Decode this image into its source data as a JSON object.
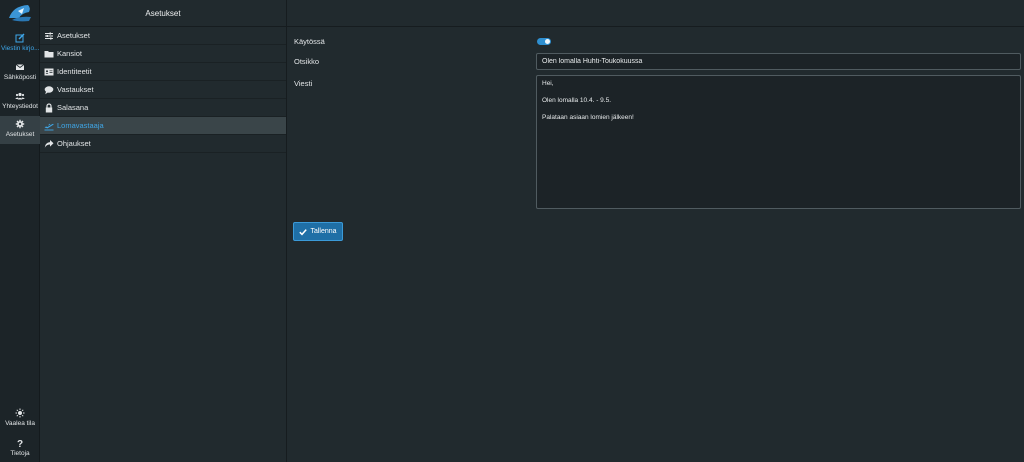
{
  "rail": {
    "items": [
      {
        "label": "Viestin kirjo...",
        "icon": "compose-icon"
      },
      {
        "label": "Sähköposti",
        "icon": "envelope-icon"
      },
      {
        "label": "Yhteystiedot",
        "icon": "users-icon"
      },
      {
        "label": "Asetukset",
        "icon": "gear-icon"
      }
    ],
    "bottom": [
      {
        "label": "Vaalea tila",
        "icon": "sun-icon"
      },
      {
        "label": "Tietoja",
        "icon": "question-icon"
      }
    ]
  },
  "menu": {
    "title": "Asetukset",
    "items": [
      {
        "label": "Asetukset",
        "icon": "sliders-icon"
      },
      {
        "label": "Kansiot",
        "icon": "folder-icon"
      },
      {
        "label": "Identiteetit",
        "icon": "id-card-icon"
      },
      {
        "label": "Vastaukset",
        "icon": "speech-bubble-icon"
      },
      {
        "label": "Salasana",
        "icon": "lock-icon"
      },
      {
        "label": "Lomavastaaja",
        "icon": "plane-departure-icon"
      },
      {
        "label": "Ohjaukset",
        "icon": "share-arrow-icon"
      }
    ],
    "selected_index": 5
  },
  "form": {
    "enabled_label": "Käytössä",
    "enabled": true,
    "subject_label": "Otsikko",
    "subject_value": "Olen lomalla Huhti-Toukokuussa",
    "message_label": "Viesti",
    "message_lines": [
      "Hei,",
      "",
      "Olen lomalla 10.4. - 9.5.",
      "",
      "Palataan asiaan lomien jälkeen!"
    ],
    "save_label": "Tallenna"
  },
  "colors": {
    "accent": "#3ea8ec",
    "background": "#212a2e",
    "selected_row": "#3a4549",
    "button": "#1f6fa6"
  }
}
